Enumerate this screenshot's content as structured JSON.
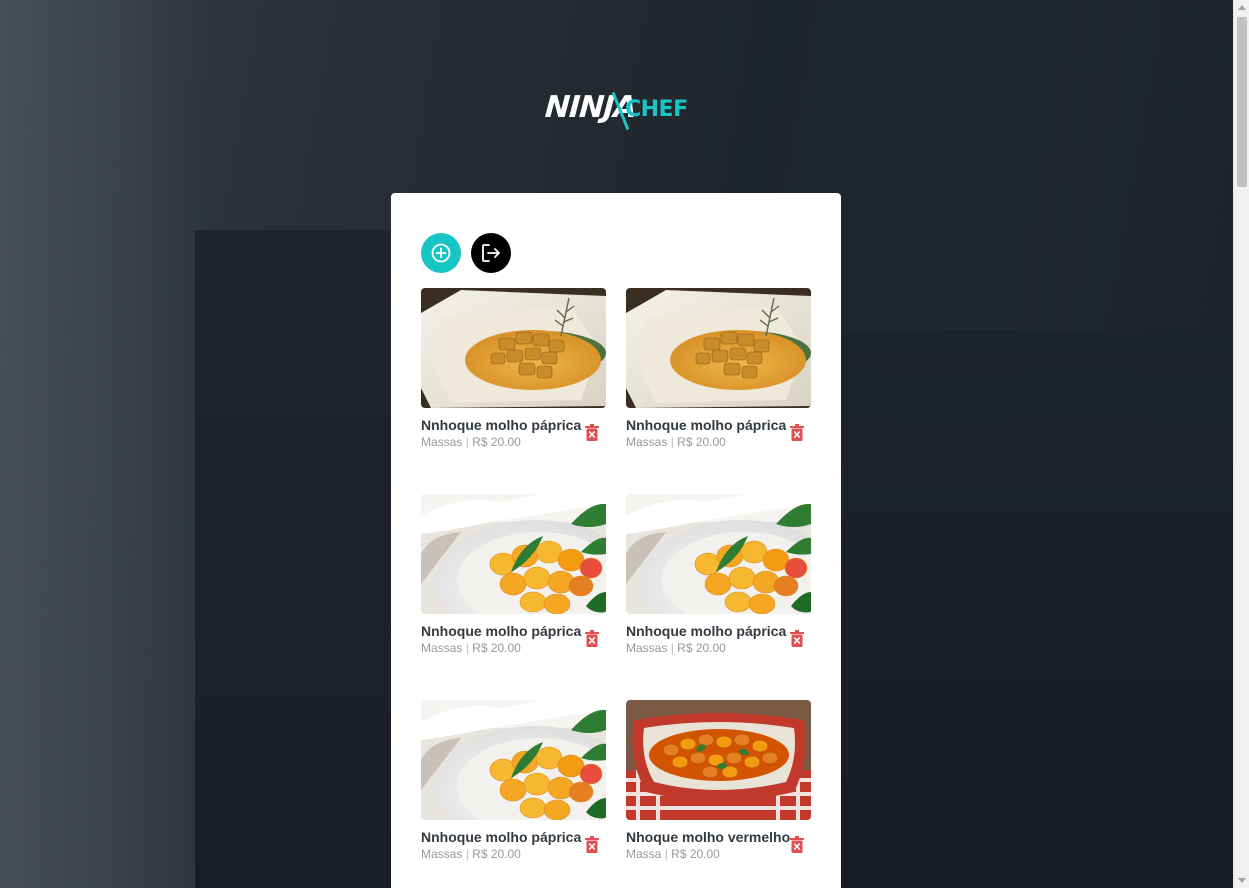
{
  "brand": {
    "logo_left": "NINJA",
    "logo_right": "CHEF",
    "accent_color": "#18c5c5"
  },
  "toolbar": {
    "add_icon": "plus-circle-icon",
    "logout_icon": "logout-icon"
  },
  "recipes": [
    {
      "title": "Nnhoque molho páprica",
      "category": "Massas",
      "price": "R$ 20.00",
      "image": "gnocchi-paprika-plate"
    },
    {
      "title": "Nnhoque molho páprica",
      "category": "Massas",
      "price": "R$ 20.00",
      "image": "gnocchi-paprika-plate"
    },
    {
      "title": "Nnhoque molho páprica",
      "category": "Massas",
      "price": "R$ 20.00",
      "image": "gnocchi-basil-bowl"
    },
    {
      "title": "Nnhoque molho páprica",
      "category": "Massas",
      "price": "R$ 20.00",
      "image": "gnocchi-basil-bowl"
    },
    {
      "title": "Nnhoque molho páprica",
      "category": "Massas",
      "price": "R$ 20.00",
      "image": "gnocchi-basil-bowl"
    },
    {
      "title": "Nhoque molho vermelho",
      "category": "Massa",
      "price": "R$ 20.00",
      "image": "gnocchi-red-baking-dish"
    }
  ],
  "colors": {
    "delete": "#e05050",
    "panel_bg": "#ffffff"
  }
}
